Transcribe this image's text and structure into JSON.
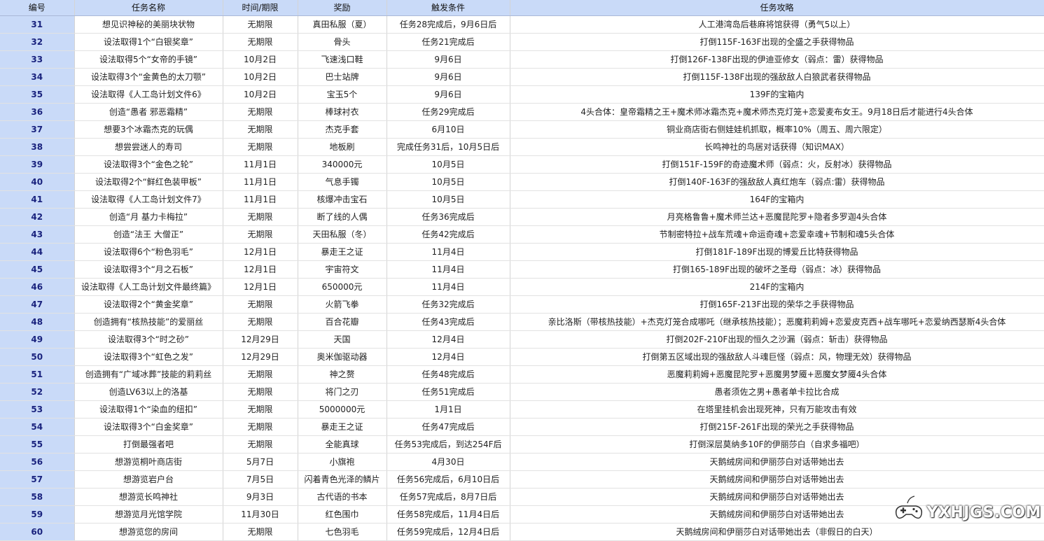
{
  "table": {
    "headers": [
      "编号",
      "任务名称",
      "时间/期限",
      "奖励",
      "触发条件",
      "任务攻略"
    ],
    "rows": [
      [
        "31",
        "想见识神秘的美丽块状物",
        "无期限",
        "真田私服（夏）",
        "任务28完成后，9月6日后",
        "人工港湾岛后巷麻将馆获得（勇气5以上）"
      ],
      [
        "32",
        "设法取得1个“白银奖章”",
        "无期限",
        "骨头",
        "任务21完成后",
        "打倒115F-163F出现的全盛之手获得物品"
      ],
      [
        "33",
        "设法取得5个“女帝的手镜”",
        "10月2日",
        "飞速浅口鞋",
        "9月6日",
        "打倒126F-138F出现的伊迪亚修女（弱点：雷）获得物品"
      ],
      [
        "34",
        "设法取得3个“金黄色的太刀颚”",
        "10月2日",
        "巴士站牌",
        "9月6日",
        "打倒115F-138F出现的强敌敌人白狼武者获得物品"
      ],
      [
        "35",
        "设法取得《人工岛计划文件6》",
        "10月2日",
        "宝玉5个",
        "9月6日",
        "139F的宝箱内"
      ],
      [
        "36",
        "创造“愚者 邪恶霜精”",
        "无期限",
        "棒球衬衣",
        "任务29完成后",
        "4头合体：皇帝霜精之王+魔术师冰霜杰克+魔术师杰克灯笼+恋爱麦布女王。9月18日后才能进行4头合体"
      ],
      [
        "37",
        "想要3个冰霜杰克的玩偶",
        "无期限",
        "杰克手套",
        "6月10日",
        "铜业商店街右侧娃娃机抓取，概率10%（周五、周六限定）"
      ],
      [
        "38",
        "想尝尝迷人的寿司",
        "无期限",
        "地板刷",
        "完成任务31后，10月5日后",
        "长鸣神社的鸟居对话获得（知识MAX）"
      ],
      [
        "39",
        "设法取得3个“金色之轮”",
        "11月1日",
        "340000元",
        "10月5日",
        "打倒151F-159F的奇迹魔术师（弱点：火，反射冰）获得物品"
      ],
      [
        "40",
        "设法取得2个“鲜红色装甲板”",
        "11月1日",
        "气息手镯",
        "10月5日",
        "打倒140F-163F的强敌敌人真红炮车（弱点:雷）获得物品"
      ],
      [
        "41",
        "设法取得《人工岛计划文件7》",
        "11月1日",
        "核爆冲击宝石",
        "10月5日",
        "164F的宝箱内"
      ],
      [
        "42",
        "创造“月 基力卡梅拉”",
        "无期限",
        "断了线的人偶",
        "任务36完成后",
        "月亮格鲁鲁+魔术师兰达+恶魔昆陀罗+隐者多罗迦4头合体"
      ],
      [
        "43",
        "创造“法王 大僧正”",
        "无期限",
        "天田私服（冬）",
        "任务42完成后",
        "节制密特拉+战车荒魂+命运奇魂+恋爱幸魂+节制和魂5头合体"
      ],
      [
        "44",
        "设法取得6个“粉色羽毛”",
        "12月1日",
        "暴走王之证",
        "11月4日",
        "打倒181F-189F出现的博爱丘比特获得物品"
      ],
      [
        "45",
        "设法取得3个“月之石板”",
        "12月1日",
        "宇宙符文",
        "11月4日",
        "打倒165-189F出现的破坏之圣母（弱点：冰）获得物品"
      ],
      [
        "46",
        "设法取得《人工岛计划文件最终篇》",
        "12月1日",
        "650000元",
        "11月4日",
        "214F的宝箱内"
      ],
      [
        "47",
        "设法取得2个“黄金奖章”",
        "无期限",
        "火箭飞拳",
        "任务32完成后",
        "打倒165F-213F出现的荣华之手获得物品"
      ],
      [
        "48",
        "创造拥有“核热技能”的爱丽丝",
        "无期限",
        "百合花瓣",
        "任务43完成后",
        "亲比洛斯（带核热技能）+杰克灯笼合成哪吒（继承核热技能）；恶魔莉莉姆+恋爱皮克西+战车哪吒+恋爱纳西瑟斯4头合体"
      ],
      [
        "49",
        "设法取得3个“时之砂”",
        "12月29日",
        "天国",
        "12月4日",
        "打倒202F-210F出现的恒久之沙漏（弱点：斩击）获得物品"
      ],
      [
        "50",
        "设法取得3个“虹色之发”",
        "12月29日",
        "奥米伽驱动器",
        "12月4日",
        "打倒第五区域出现的强敌敌人斗魂巨怪（弱点：风，物理无效）获得物品"
      ],
      [
        "51",
        "创造拥有“广域冰葬”技能的莉莉丝",
        "无期限",
        "神之赘",
        "任务48完成后",
        "恶魔莉莉姆+恶魔昆陀罗+恶魔男梦魇+恶魔女梦魇4头合体"
      ],
      [
        "52",
        "创造LV63以上的洛基",
        "无期限",
        "将门之刃",
        "任务51完成后",
        "愚者须佐之男+愚者单卡拉比合成"
      ],
      [
        "53",
        "设法取得1个“染血的纽扣”",
        "无期限",
        "5000000元",
        "1月1日",
        "在塔里挂机会出现死神，只有万能攻击有效"
      ],
      [
        "54",
        "设法取得3个“白金奖章”",
        "无期限",
        "暴走王之证",
        "任务47完成后",
        "打倒215F-261F出现的荣光之手获得物品"
      ],
      [
        "55",
        "打倒最强者吧",
        "无期限",
        "全能真球",
        "任务53完成后，到达254F后",
        "打倒深层莫纳多10F的伊丽莎白（自求多福吧）"
      ],
      [
        "56",
        "想游览桐叶商店街",
        "5月7日",
        "小旗袍",
        "4月30日",
        "天鹅绒房间和伊丽莎白对话带她出去"
      ],
      [
        "57",
        "想游览岩户台",
        "7月5日",
        "闪着青色光泽的鳞片",
        "任务56完成后，6月10日后",
        "天鹅绒房间和伊丽莎白对话带她出去"
      ],
      [
        "58",
        "想游览长鸣神社",
        "9月3日",
        "古代语的书本",
        "任务57完成后，8月7日后",
        "天鹅绒房间和伊丽莎白对话带她出去"
      ],
      [
        "59",
        "想游览月光馆学院",
        "11月30日",
        "红色围巾",
        "任务58完成后，11月4日后",
        "天鹅绒房间和伊丽莎白对话带她出去"
      ],
      [
        "60",
        "想游览您的房间",
        "无期限",
        "七色羽毛",
        "任务59完成后，12月4日后",
        "天鹅绒房间和伊丽莎白对话带她出去（非假日的白天）"
      ]
    ]
  },
  "watermark": {
    "text": "YXHJGS.COM",
    "icon": "gamepad-logo-icon"
  }
}
